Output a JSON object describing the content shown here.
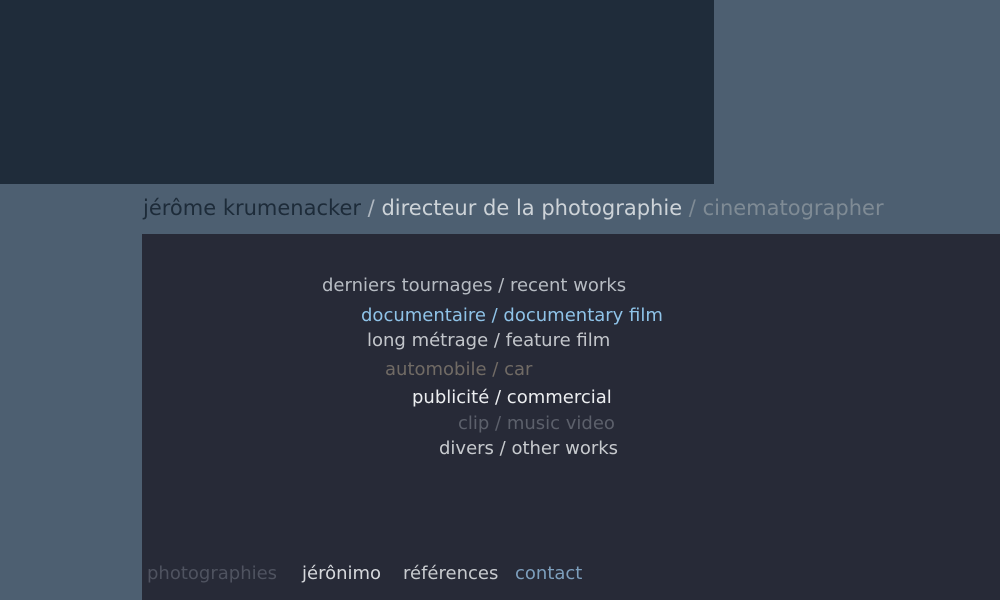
{
  "header": {
    "name": "jérôme krumenacker",
    "separator_1": " / ",
    "title_fr": "directeur de la photographie",
    "separator_2": " / ",
    "title_en": "cinematographer"
  },
  "menu": {
    "title": "derniers tournages / recent works",
    "items": [
      {
        "label": "documentaire / documentary film"
      },
      {
        "label": "long métrage / feature film"
      },
      {
        "label": "automobile / car"
      },
      {
        "label": "publicité / commercial"
      },
      {
        "label": "clip / music video"
      },
      {
        "label": "divers / other works"
      }
    ]
  },
  "footer": {
    "links": [
      {
        "label": "photographies"
      },
      {
        "label": "jérônimo"
      },
      {
        "label": "références"
      },
      {
        "label": "contact"
      }
    ]
  },
  "colors": {
    "page_background": "#4d5f71",
    "top_block": "#1f2c3a",
    "panel_background": "#272a37",
    "active_link": "#8fc3e8",
    "contact_link": "#7d9fbd"
  }
}
